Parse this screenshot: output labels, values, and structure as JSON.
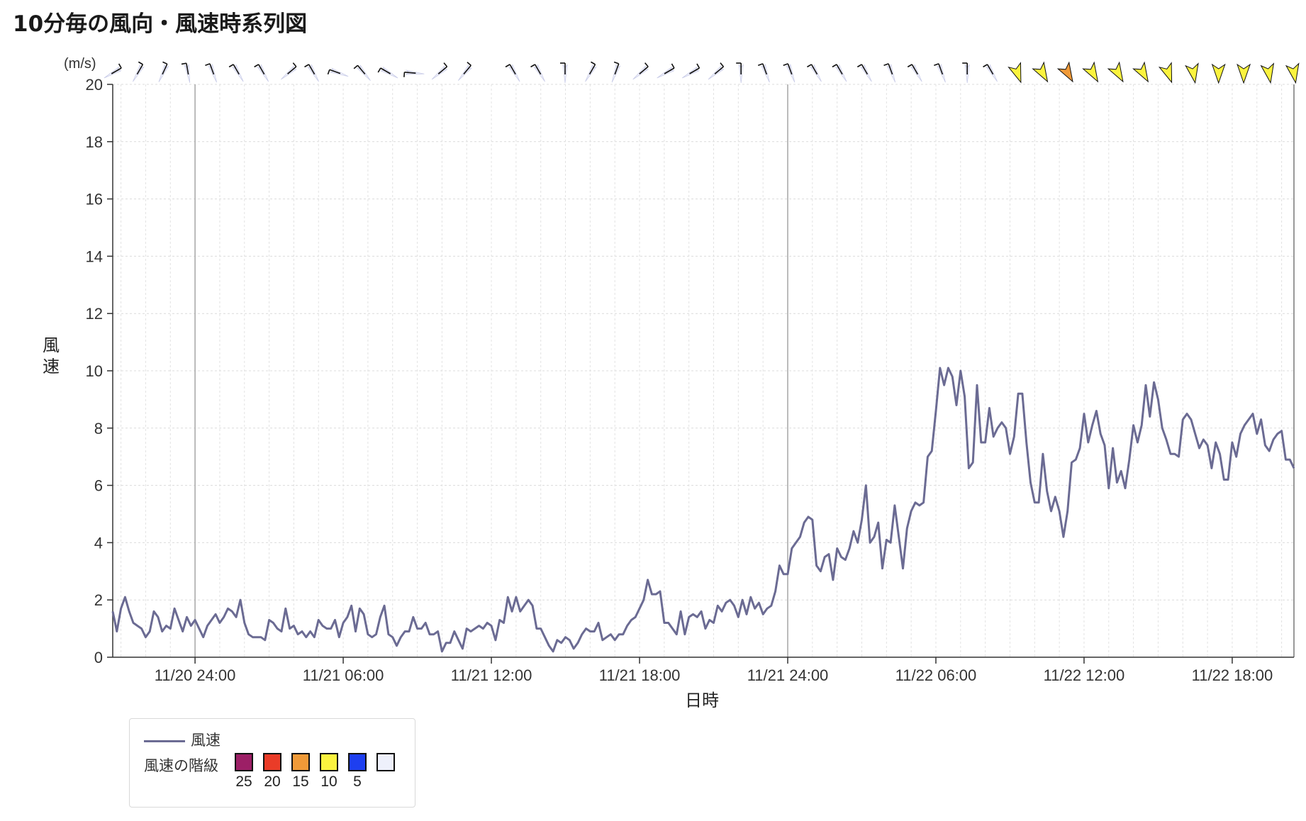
{
  "title": "10分毎の風向・風速時系列図",
  "chart_data": {
    "type": "line",
    "title": "10分毎の風向・風速時系列図",
    "xlabel": "日時",
    "ylabel": "風速",
    "yunit": "(m/s)",
    "ylim": [
      0,
      20
    ],
    "yticks": [
      0,
      2,
      4,
      6,
      8,
      10,
      12,
      14,
      16,
      18,
      20
    ],
    "xticks": [
      "11/20 24:00",
      "11/21 06:00",
      "11/21 12:00",
      "11/21 18:00",
      "11/21 24:00",
      "11/22 06:00",
      "11/22 12:00",
      "11/22 18:00"
    ],
    "xrange": [
      "11/20 20:40",
      "11/22 20:30"
    ],
    "grid": true,
    "interval_minutes": 10,
    "series": [
      {
        "name": "風速",
        "color": "#6b6b93",
        "values": [
          1.6,
          0.9,
          1.7,
          2.1,
          1.6,
          1.2,
          1.1,
          1.0,
          0.7,
          0.9,
          1.6,
          1.4,
          0.9,
          1.1,
          1.0,
          1.7,
          1.3,
          0.9,
          1.4,
          1.1,
          1.3,
          1.0,
          0.7,
          1.1,
          1.3,
          1.5,
          1.2,
          1.4,
          1.7,
          1.6,
          1.4,
          2.0,
          1.2,
          0.8,
          0.7,
          0.7,
          0.7,
          0.6,
          1.3,
          1.2,
          1.0,
          0.9,
          1.7,
          1.0,
          1.1,
          0.8,
          0.9,
          0.7,
          0.9,
          0.7,
          1.3,
          1.1,
          1.0,
          1.0,
          1.3,
          0.7,
          1.2,
          1.4,
          1.8,
          0.9,
          1.7,
          1.5,
          0.8,
          0.7,
          0.8,
          1.4,
          1.8,
          0.8,
          0.7,
          0.4,
          0.7,
          0.9,
          0.9,
          1.4,
          1.0,
          1.0,
          1.2,
          0.8,
          0.8,
          0.9,
          0.2,
          0.5,
          0.5,
          0.9,
          0.6,
          0.3,
          1.0,
          0.9,
          1.0,
          1.1,
          1.0,
          1.2,
          1.1,
          0.6,
          1.3,
          1.2,
          2.1,
          1.6,
          2.1,
          1.6,
          1.8,
          2.0,
          1.8,
          1.0,
          1.0,
          0.7,
          0.4,
          0.2,
          0.6,
          0.5,
          0.7,
          0.6,
          0.3,
          0.5,
          0.8,
          1.0,
          0.9,
          0.9,
          1.2,
          0.6,
          0.7,
          0.8,
          0.6,
          0.8,
          0.8,
          1.1,
          1.3,
          1.4,
          1.7,
          2.0,
          2.7,
          2.2,
          2.2,
          2.3,
          1.2,
          1.2,
          1.0,
          0.8,
          1.6,
          0.8,
          1.4,
          1.5,
          1.4,
          1.6,
          1.0,
          1.3,
          1.2,
          1.8,
          1.6,
          1.9,
          2.0,
          1.8,
          1.4,
          2.0,
          1.5,
          2.1,
          1.7,
          1.9,
          1.5,
          1.7,
          1.8,
          2.3,
          3.2,
          2.9,
          2.9,
          3.8,
          4.0,
          4.2,
          4.7,
          4.9,
          4.8,
          3.2,
          3.0,
          3.5,
          3.6,
          2.7,
          3.8,
          3.5,
          3.4,
          3.8,
          4.4,
          4.0,
          4.8,
          6.0,
          4.0,
          4.2,
          4.7,
          3.1,
          4.1,
          4.0,
          5.3,
          4.2,
          3.1,
          4.5,
          5.1,
          5.4,
          5.3,
          5.4,
          7.0,
          7.2,
          8.6,
          10.1,
          9.5,
          10.1,
          9.8,
          8.8,
          10.0,
          9.1,
          6.6,
          6.8,
          9.5,
          7.5,
          7.5,
          8.7,
          7.7,
          8.0,
          8.2,
          8.0,
          7.1,
          7.7,
          9.2,
          9.2,
          7.5,
          6.1,
          5.4,
          5.4,
          7.1,
          5.8,
          5.1,
          5.6,
          5.1,
          4.2,
          5.1,
          6.8,
          6.9,
          7.3,
          8.5,
          7.5,
          8.1,
          8.6,
          7.8,
          7.4,
          5.9,
          7.3,
          6.1,
          6.5,
          5.9,
          6.9,
          8.1,
          7.5,
          8.1,
          9.5,
          8.4,
          9.6,
          9.0,
          8.0,
          7.6,
          7.1,
          7.1,
          7.0,
          8.3,
          8.5,
          8.3,
          7.8,
          7.3,
          7.6,
          7.4,
          6.6,
          7.5,
          7.1,
          6.2,
          6.2,
          7.5,
          7.0,
          7.8,
          8.1,
          8.3,
          8.5,
          7.8,
          8.3,
          7.4,
          7.2,
          7.6,
          7.8,
          7.9,
          6.9,
          6.9,
          6.6
        ]
      }
    ],
    "wind_direction_row": {
      "count": 48,
      "angles_deg": [
        240,
        210,
        205,
        170,
        160,
        150,
        150,
        230,
        150,
        110,
        140,
        120,
        95,
        230,
        220,
        null,
        150,
        150,
        180,
        210,
        200,
        230,
        240,
        240,
        230,
        180,
        160,
        160,
        150,
        150,
        150,
        160,
        150,
        160,
        180,
        150,
        160,
        150,
        150,
        150,
        150,
        150,
        160,
        170,
        180,
        180,
        170,
        170
      ],
      "classes": [
        "5",
        "5",
        "5",
        "5",
        "5",
        "5",
        "5",
        "5",
        "5",
        "5",
        "5",
        "5",
        "5",
        "5",
        "5",
        null,
        "5",
        "5",
        "5",
        "5",
        "5",
        "5",
        "5",
        "5",
        "5",
        "5",
        "5",
        "5",
        "5",
        "5",
        "5",
        "5",
        "5",
        "5",
        "5",
        "5",
        "10",
        "10",
        "15",
        "10",
        "10",
        "10",
        "10",
        "10",
        "10",
        "10",
        "10",
        "10"
      ]
    }
  },
  "legend": {
    "series_label": "風速",
    "class_label": "風速の階級",
    "classes": [
      {
        "label": "25",
        "color": "#9c1f66"
      },
      {
        "label": "20",
        "color": "#ea3c28"
      },
      {
        "label": "15",
        "color": "#f09a38"
      },
      {
        "label": "10",
        "color": "#fbf33f"
      },
      {
        "label": "5",
        "color": "#1e3ff0"
      },
      {
        "label": "",
        "color": "#eef0fb"
      }
    ]
  }
}
